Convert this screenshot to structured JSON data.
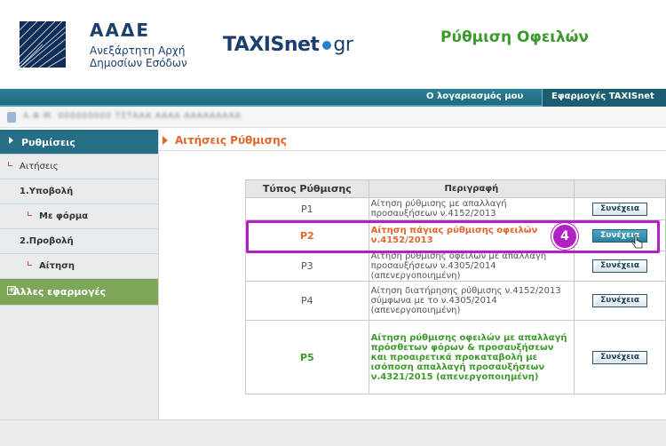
{
  "header": {
    "org_title": "ΑΑΔΕ",
    "org_sub_line1": "Ανεξάρτητη Αρχή",
    "org_sub_line2": "Δημοσίων Εσόδων",
    "brand": "TAXISnet",
    "brand_suffix": "gr",
    "page_heading": "Ρύθμιση Οφειλών",
    "colors": {
      "navy": "#1c3f6e",
      "green": "#3a9a2a",
      "teal": "#246f86"
    }
  },
  "topnav": {
    "my_account": "Ο λογαριασμός μου",
    "apps": "Εφαρμογές TAXISnet"
  },
  "user_strip": {
    "text": "Α.Φ.Μ. 000000000 ΤΣΤΑΑΑ ΑΑΑΑ ΑΑΑΑΑΑΑΑΑ"
  },
  "sidebar": {
    "settings": "Ρυθμίσεις",
    "applications": "Αιτήσεις",
    "submit": "1.Υποβολή",
    "with_form": "Με φόρμα",
    "view": "2.Προβολή",
    "application": "Αίτηση",
    "other_apps": "Άλλες εφαρμογές"
  },
  "main": {
    "section_title": "Αιτήσεις Ρύθμισης",
    "table": {
      "headers": [
        "Τύπος Ρύθμισης",
        "Περιγραφή",
        ""
      ],
      "rows": [
        {
          "type": "P1",
          "desc": "Αίτηση ρύθμισης με απαλλαγή προσαυξήσεων ν.4152/2013",
          "button": "Συνέχεια"
        },
        {
          "type": "P2",
          "desc": "Αίτηση πάγιας ρύθμισης οφειλών ν.4152/2013",
          "button": "Συνέχεια"
        },
        {
          "type": "P3",
          "desc": "Αίτηση ρύθμισης οφειλών με απαλλαγή προσαυξήσεων ν.4305/2014 (απενεργοποιημένη)",
          "button": "Συνέχεια"
        },
        {
          "type": "P4",
          "desc": "Αίτηση διατήρησης ρύθμισης ν.4152/2013 σύμφωνα με το ν.4305/2014 (απενεργοποιημένη)",
          "button": "Συνέχεια"
        },
        {
          "type": "P5",
          "desc": "Αίτηση ρύθμισης οφειλών με απαλλαγή πρόσθετων φόρων & προσαυξήσεων και προαιρετικά προκαταβολή με ισόποση απαλλαγή προσαυξήσεων ν.4321/2015 (απενεργοποιημένη)",
          "button": "Συνέχεια"
        }
      ]
    }
  },
  "annotation": {
    "step_number": "4",
    "highlight_color": "#b221c4"
  }
}
